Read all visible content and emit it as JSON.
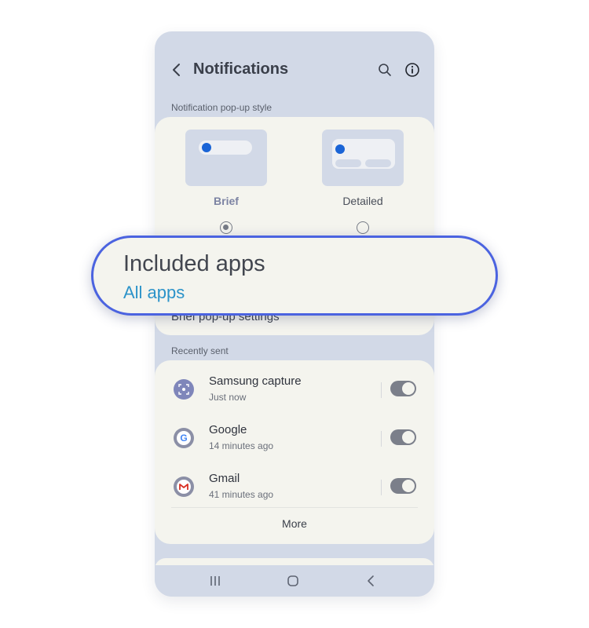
{
  "header": {
    "title": "Notifications"
  },
  "popup_style": {
    "section_label": "Notification pop-up style",
    "options": [
      {
        "label": "Brief",
        "selected": true
      },
      {
        "label": "Detailed",
        "selected": false
      }
    ],
    "brief_settings_label": "Brief pop-up settings"
  },
  "callout": {
    "title": "Included apps",
    "value": "All apps"
  },
  "recently_sent": {
    "section_label": "Recently sent",
    "apps": [
      {
        "name": "Samsung capture",
        "time": "Just now",
        "icon": "samsung-capture-icon",
        "enabled": true
      },
      {
        "name": "Google",
        "time": "14 minutes ago",
        "icon": "google-icon",
        "enabled": true
      },
      {
        "name": "Gmail",
        "time": "41 minutes ago",
        "icon": "gmail-icon",
        "enabled": true
      }
    ],
    "more_label": "More"
  },
  "colors": {
    "phone_bg": "#d2d9e7",
    "card_bg": "#f4f4ee",
    "accent_blue": "#1a64d6",
    "callout_border": "#4b63e0",
    "callout_value": "#2c93c9"
  }
}
